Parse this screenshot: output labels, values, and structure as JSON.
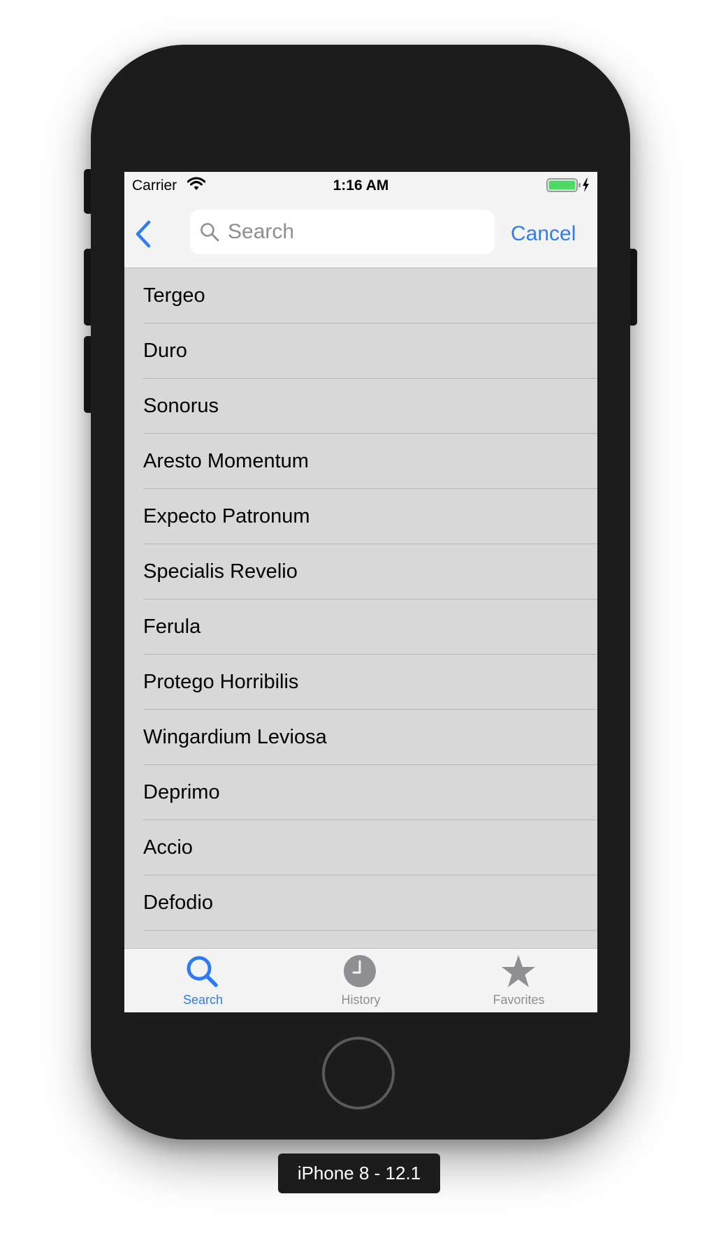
{
  "status_bar": {
    "carrier": "Carrier",
    "time": "1:16 AM"
  },
  "nav": {
    "search_placeholder": "Search",
    "search_value": "",
    "cancel_label": "Cancel"
  },
  "list": {
    "items": [
      "Tergeo",
      "Duro",
      "Sonorus",
      "Aresto Momentum",
      "Expecto Patronum",
      "Specialis Revelio",
      "Ferula",
      "Protego Horribilis",
      "Wingardium Leviosa",
      "Deprimo",
      "Accio",
      "Defodio"
    ]
  },
  "tabbar": {
    "tabs": [
      {
        "label": "Search",
        "icon": "search-icon",
        "active": true
      },
      {
        "label": "History",
        "icon": "clock-icon",
        "active": false
      },
      {
        "label": "Favorites",
        "icon": "star-icon",
        "active": false
      }
    ]
  },
  "device_label": "iPhone 8 - 12.1",
  "colors": {
    "accent": "#2d7cf6",
    "list_background": "#d8d8d8",
    "bar_background": "#f4f4f4",
    "inactive_tab": "#8e8e93",
    "phone_body": "#1c1c1c",
    "battery_fill": "#4cd964"
  }
}
